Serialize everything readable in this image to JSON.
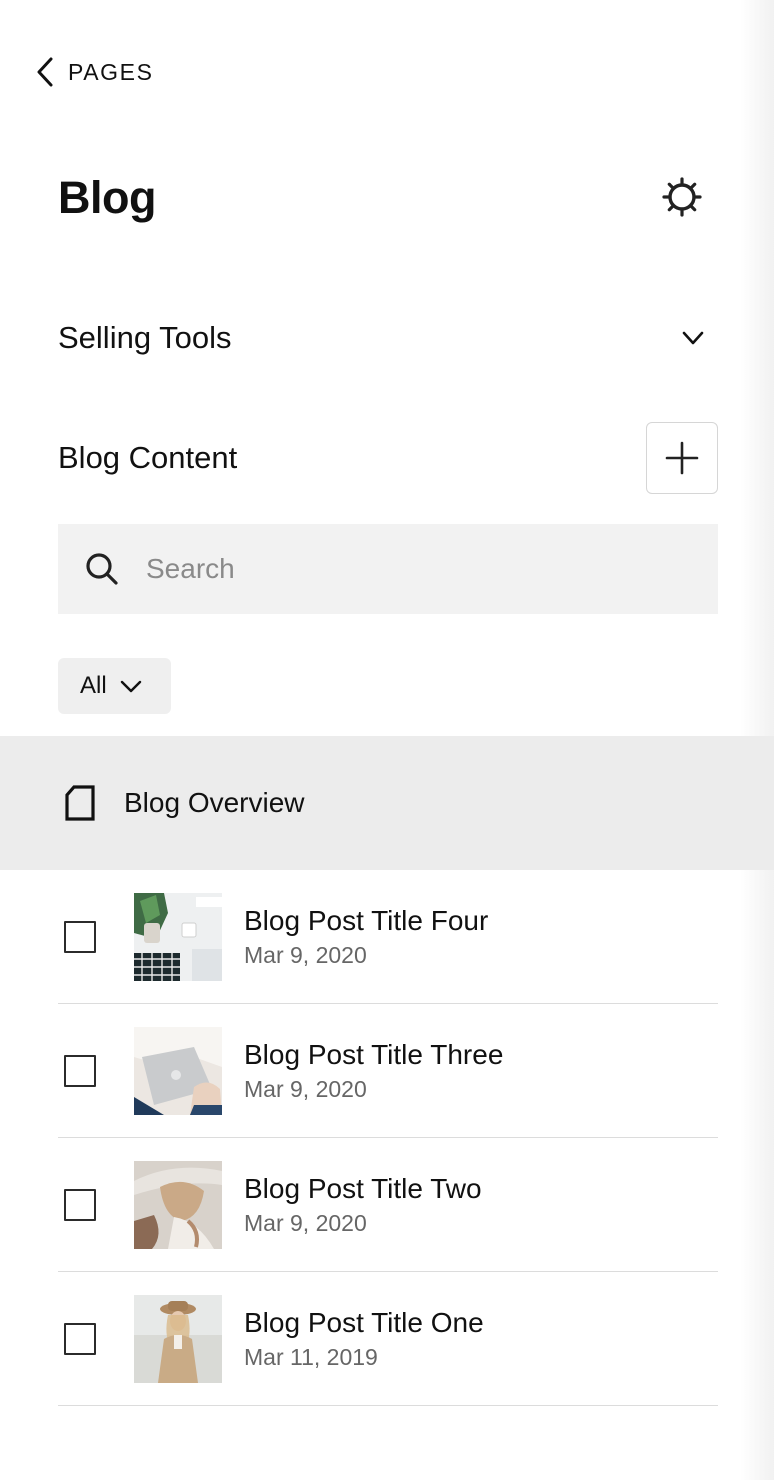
{
  "nav": {
    "back_label": "PAGES"
  },
  "page": {
    "title": "Blog"
  },
  "selling_tools": {
    "label": "Selling Tools"
  },
  "blog_content": {
    "label": "Blog Content"
  },
  "search": {
    "placeholder": "Search",
    "value": ""
  },
  "filter": {
    "selected": "All"
  },
  "overview": {
    "label": "Blog Overview"
  },
  "posts": [
    {
      "title": "Blog Post Title Four",
      "date": "Mar 9, 2020",
      "thumbnail": "desk-with-plant-and-mug-photo"
    },
    {
      "title": "Blog Post Title Three",
      "date": "Mar 9, 2020",
      "thumbnail": "hands-on-laptop-photo"
    },
    {
      "title": "Blog Post Title Two",
      "date": "Mar 9, 2020",
      "thumbnail": "woman-in-hat-side-photo"
    },
    {
      "title": "Blog Post Title One",
      "date": "Mar 11, 2019",
      "thumbnail": "woman-in-hat-front-photo"
    }
  ],
  "icons": {
    "back": "chevron-left-icon",
    "settings": "gear-icon",
    "expand": "chevron-down-icon",
    "add": "plus-icon",
    "search": "search-icon",
    "filter": "chevron-down-icon",
    "overview": "page-icon"
  }
}
